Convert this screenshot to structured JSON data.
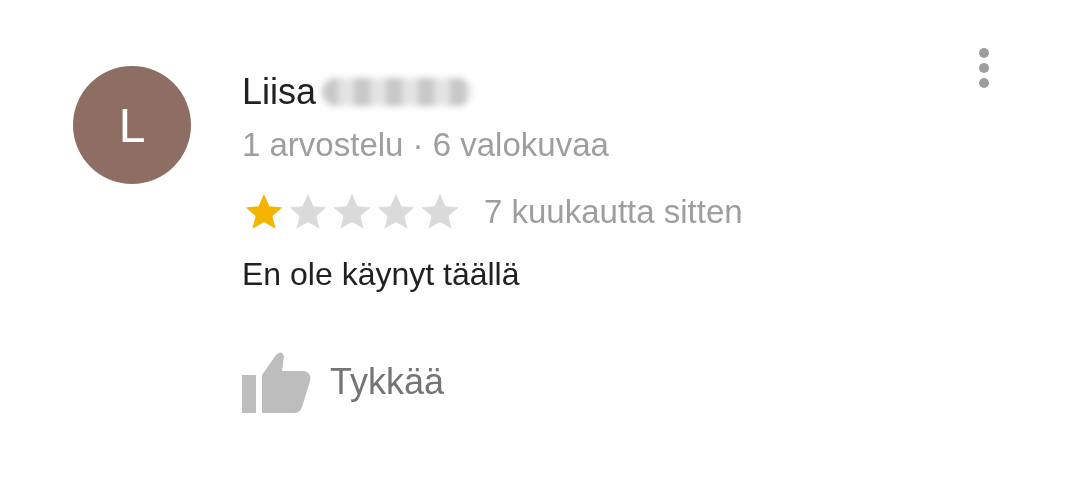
{
  "review": {
    "avatar_letter": "L",
    "author": "Liisa",
    "author_meta": "1 arvostelu · 6 valokuvaa",
    "stars": 1,
    "time": "7 kuukautta sitten",
    "text": "En ole käynyt täällä",
    "like_label": "Tykkää"
  }
}
